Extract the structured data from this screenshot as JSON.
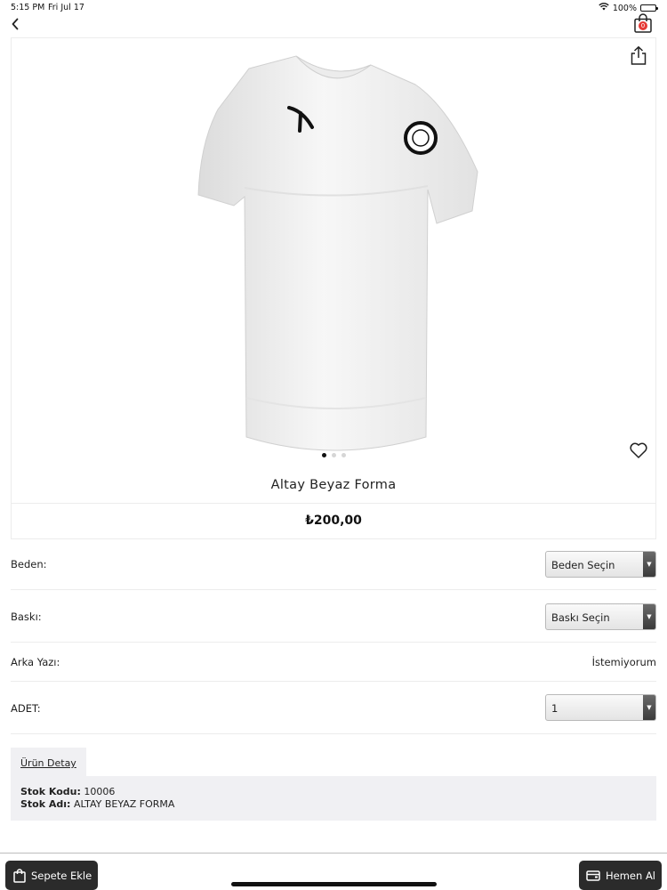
{
  "status_bar": {
    "time": "5:15 PM",
    "date": "Fri Jul 17",
    "battery": "100%"
  },
  "header": {
    "back_icon": "chevron-left-icon",
    "cart_icon": "shopping-bag-icon",
    "cart_count": "0"
  },
  "product": {
    "title": "Altay Beyaz Forma",
    "price": "₺200,00",
    "share_icon": "share-icon",
    "favorite_icon": "heart-icon",
    "image_count": 3,
    "active_image": 0
  },
  "options": {
    "size_label": "Beden:",
    "size_value": "Beden Seçin",
    "print_label": "Baskı:",
    "print_value": "Baskı Seçin",
    "back_text_label": "Arka Yazı:",
    "back_text_value": "İstemiyorum",
    "quantity_label": "ADET:",
    "quantity_value": "1"
  },
  "details": {
    "tab_label": "Ürün Detay",
    "stock_code_label": "Stok Kodu:",
    "stock_code_value": "10006",
    "stock_name_label": "Stok Adı:",
    "stock_name_value": "ALTAY BEYAZ FORMA"
  },
  "actions": {
    "add_to_cart": "Sepete Ekle",
    "buy_now": "Hemen Al"
  },
  "colors": {
    "button_bg": "#2b2b2b",
    "badge": "#e53935",
    "panel_bg": "#f0f0f3"
  }
}
